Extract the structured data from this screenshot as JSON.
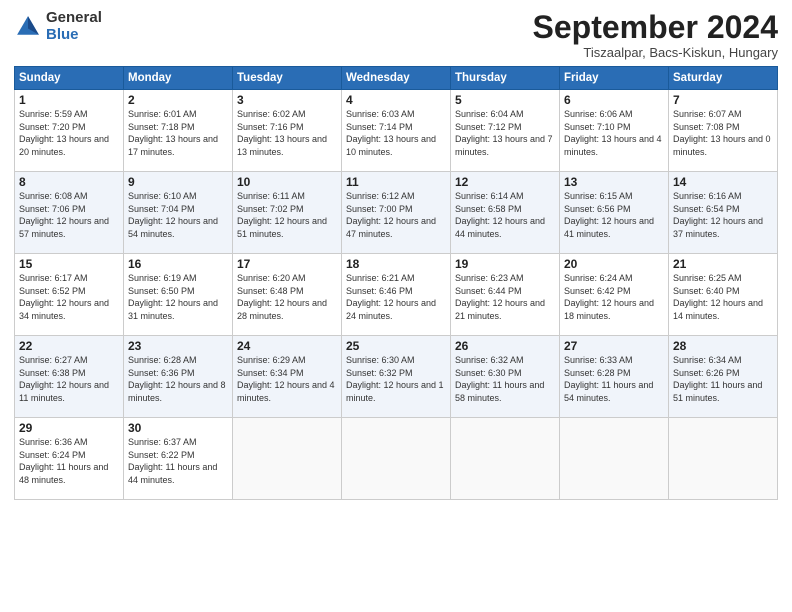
{
  "logo": {
    "general": "General",
    "blue": "Blue"
  },
  "title": "September 2024",
  "location": "Tiszaalpar, Bacs-Kiskun, Hungary",
  "days_header": [
    "Sunday",
    "Monday",
    "Tuesday",
    "Wednesday",
    "Thursday",
    "Friday",
    "Saturday"
  ],
  "weeks": [
    [
      {
        "day": "1",
        "sunrise": "5:59 AM",
        "sunset": "7:20 PM",
        "daylight": "13 hours and 20 minutes."
      },
      {
        "day": "2",
        "sunrise": "6:01 AM",
        "sunset": "7:18 PM",
        "daylight": "13 hours and 17 minutes."
      },
      {
        "day": "3",
        "sunrise": "6:02 AM",
        "sunset": "7:16 PM",
        "daylight": "13 hours and 13 minutes."
      },
      {
        "day": "4",
        "sunrise": "6:03 AM",
        "sunset": "7:14 PM",
        "daylight": "13 hours and 10 minutes."
      },
      {
        "day": "5",
        "sunrise": "6:04 AM",
        "sunset": "7:12 PM",
        "daylight": "13 hours and 7 minutes."
      },
      {
        "day": "6",
        "sunrise": "6:06 AM",
        "sunset": "7:10 PM",
        "daylight": "13 hours and 4 minutes."
      },
      {
        "day": "7",
        "sunrise": "6:07 AM",
        "sunset": "7:08 PM",
        "daylight": "13 hours and 0 minutes."
      }
    ],
    [
      {
        "day": "8",
        "sunrise": "6:08 AM",
        "sunset": "7:06 PM",
        "daylight": "12 hours and 57 minutes."
      },
      {
        "day": "9",
        "sunrise": "6:10 AM",
        "sunset": "7:04 PM",
        "daylight": "12 hours and 54 minutes."
      },
      {
        "day": "10",
        "sunrise": "6:11 AM",
        "sunset": "7:02 PM",
        "daylight": "12 hours and 51 minutes."
      },
      {
        "day": "11",
        "sunrise": "6:12 AM",
        "sunset": "7:00 PM",
        "daylight": "12 hours and 47 minutes."
      },
      {
        "day": "12",
        "sunrise": "6:14 AM",
        "sunset": "6:58 PM",
        "daylight": "12 hours and 44 minutes."
      },
      {
        "day": "13",
        "sunrise": "6:15 AM",
        "sunset": "6:56 PM",
        "daylight": "12 hours and 41 minutes."
      },
      {
        "day": "14",
        "sunrise": "6:16 AM",
        "sunset": "6:54 PM",
        "daylight": "12 hours and 37 minutes."
      }
    ],
    [
      {
        "day": "15",
        "sunrise": "6:17 AM",
        "sunset": "6:52 PM",
        "daylight": "12 hours and 34 minutes."
      },
      {
        "day": "16",
        "sunrise": "6:19 AM",
        "sunset": "6:50 PM",
        "daylight": "12 hours and 31 minutes."
      },
      {
        "day": "17",
        "sunrise": "6:20 AM",
        "sunset": "6:48 PM",
        "daylight": "12 hours and 28 minutes."
      },
      {
        "day": "18",
        "sunrise": "6:21 AM",
        "sunset": "6:46 PM",
        "daylight": "12 hours and 24 minutes."
      },
      {
        "day": "19",
        "sunrise": "6:23 AM",
        "sunset": "6:44 PM",
        "daylight": "12 hours and 21 minutes."
      },
      {
        "day": "20",
        "sunrise": "6:24 AM",
        "sunset": "6:42 PM",
        "daylight": "12 hours and 18 minutes."
      },
      {
        "day": "21",
        "sunrise": "6:25 AM",
        "sunset": "6:40 PM",
        "daylight": "12 hours and 14 minutes."
      }
    ],
    [
      {
        "day": "22",
        "sunrise": "6:27 AM",
        "sunset": "6:38 PM",
        "daylight": "12 hours and 11 minutes."
      },
      {
        "day": "23",
        "sunrise": "6:28 AM",
        "sunset": "6:36 PM",
        "daylight": "12 hours and 8 minutes."
      },
      {
        "day": "24",
        "sunrise": "6:29 AM",
        "sunset": "6:34 PM",
        "daylight": "12 hours and 4 minutes."
      },
      {
        "day": "25",
        "sunrise": "6:30 AM",
        "sunset": "6:32 PM",
        "daylight": "12 hours and 1 minute."
      },
      {
        "day": "26",
        "sunrise": "6:32 AM",
        "sunset": "6:30 PM",
        "daylight": "11 hours and 58 minutes."
      },
      {
        "day": "27",
        "sunrise": "6:33 AM",
        "sunset": "6:28 PM",
        "daylight": "11 hours and 54 minutes."
      },
      {
        "day": "28",
        "sunrise": "6:34 AM",
        "sunset": "6:26 PM",
        "daylight": "11 hours and 51 minutes."
      }
    ],
    [
      {
        "day": "29",
        "sunrise": "6:36 AM",
        "sunset": "6:24 PM",
        "daylight": "11 hours and 48 minutes."
      },
      {
        "day": "30",
        "sunrise": "6:37 AM",
        "sunset": "6:22 PM",
        "daylight": "11 hours and 44 minutes."
      },
      null,
      null,
      null,
      null,
      null
    ]
  ],
  "labels": {
    "sunrise": "Sunrise:",
    "sunset": "Sunset:",
    "daylight": "Daylight:"
  }
}
